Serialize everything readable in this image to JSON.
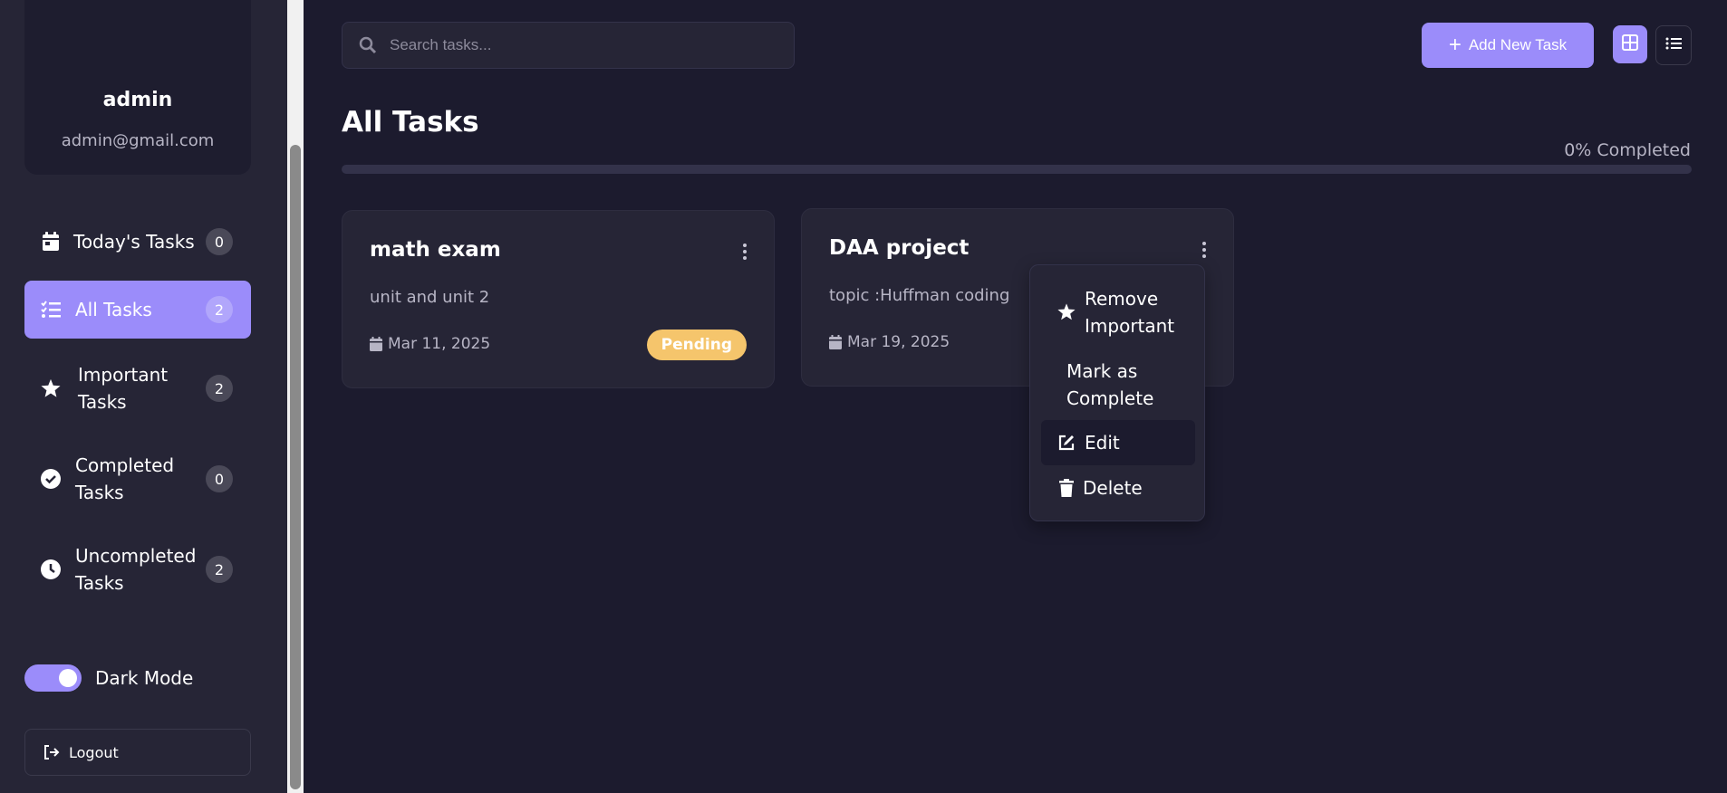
{
  "profile": {
    "name": "admin",
    "email": "admin@gmail.com"
  },
  "sidebar": {
    "items": [
      {
        "label": "Today's Tasks",
        "count": "0"
      },
      {
        "label": "All Tasks",
        "count": "2"
      },
      {
        "label": "Important Tasks",
        "count": "2"
      },
      {
        "label": "Completed Tasks",
        "count": "0"
      },
      {
        "label": "Uncompleted Tasks",
        "count": "2"
      }
    ],
    "dark_mode_label": "Dark Mode",
    "logout_label": "Logout"
  },
  "header": {
    "search_placeholder": "Search tasks...",
    "add_button_label": "Add New Task"
  },
  "main": {
    "title": "All Tasks",
    "progress_text": "0% Completed",
    "progress_value": 0
  },
  "tasks": [
    {
      "title": "math exam",
      "description": "unit and unit 2",
      "date": "Mar 11, 2025",
      "status": "Pending"
    },
    {
      "title": "DAA project",
      "description": "topic :Huffman coding",
      "date": "Mar 19, 2025"
    }
  ],
  "context_menu": {
    "remove_important": "Remove Important",
    "mark_complete": "Mark as Complete",
    "edit": "Edit",
    "delete": "Delete"
  },
  "colors": {
    "accent": "#9b8cfa",
    "background": "#1c1b2e",
    "surface": "#262536",
    "pending": "#f5c56c"
  }
}
